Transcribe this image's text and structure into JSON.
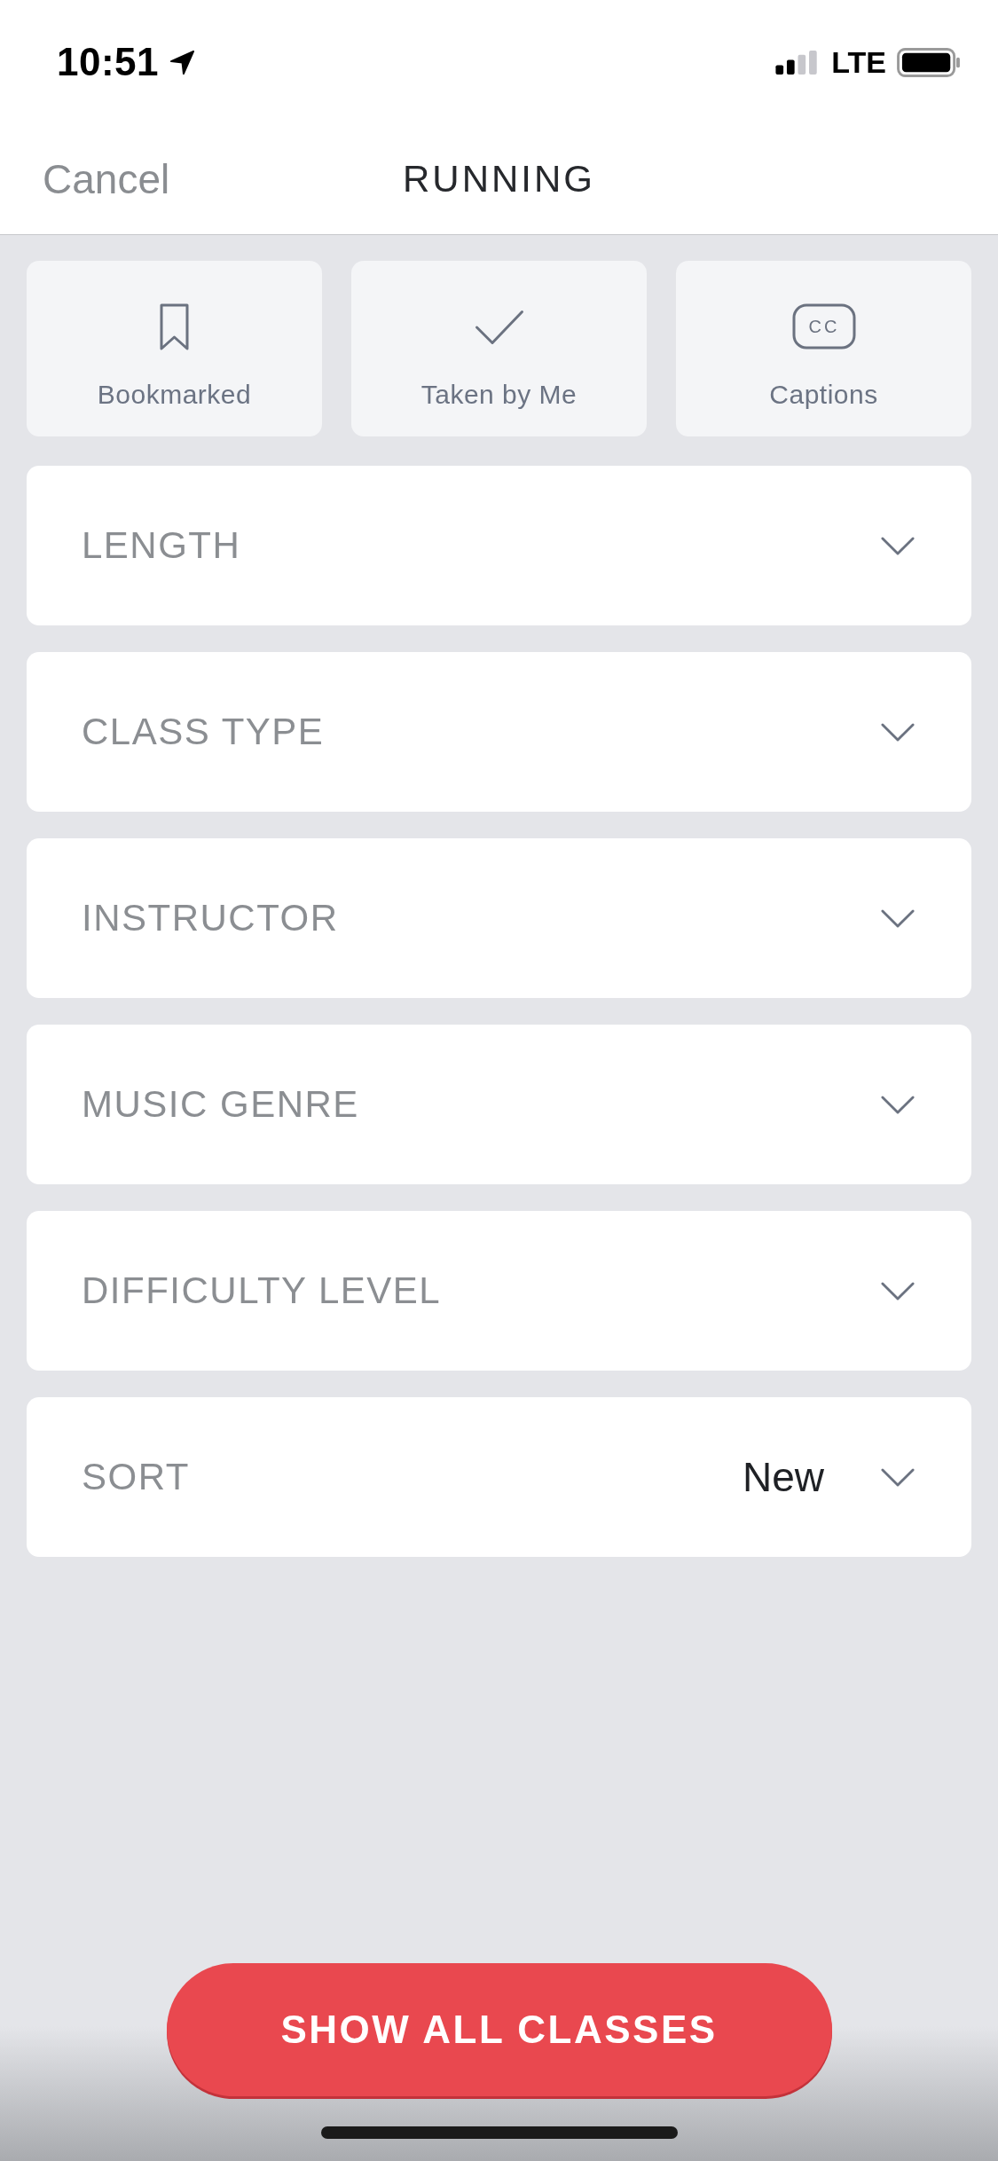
{
  "status_bar": {
    "time": "10:51",
    "network": "LTE"
  },
  "header": {
    "cancel": "Cancel",
    "title": "RUNNING"
  },
  "quick_filters": [
    {
      "kind": "bookmark",
      "label": "Bookmarked",
      "selected": false
    },
    {
      "kind": "check",
      "label": "Taken by Me",
      "selected": false
    },
    {
      "kind": "captions",
      "label": "Captions",
      "icon_text": "CC",
      "selected": false
    }
  ],
  "filters": [
    {
      "label": "LENGTH"
    },
    {
      "label": "CLASS TYPE"
    },
    {
      "label": "INSTRUCTOR"
    },
    {
      "label": "MUSIC GENRE"
    },
    {
      "label": "DIFFICULTY LEVEL"
    },
    {
      "label": "SORT",
      "value": "New"
    }
  ],
  "show_button": {
    "label": "SHOW ALL CLASSES"
  }
}
